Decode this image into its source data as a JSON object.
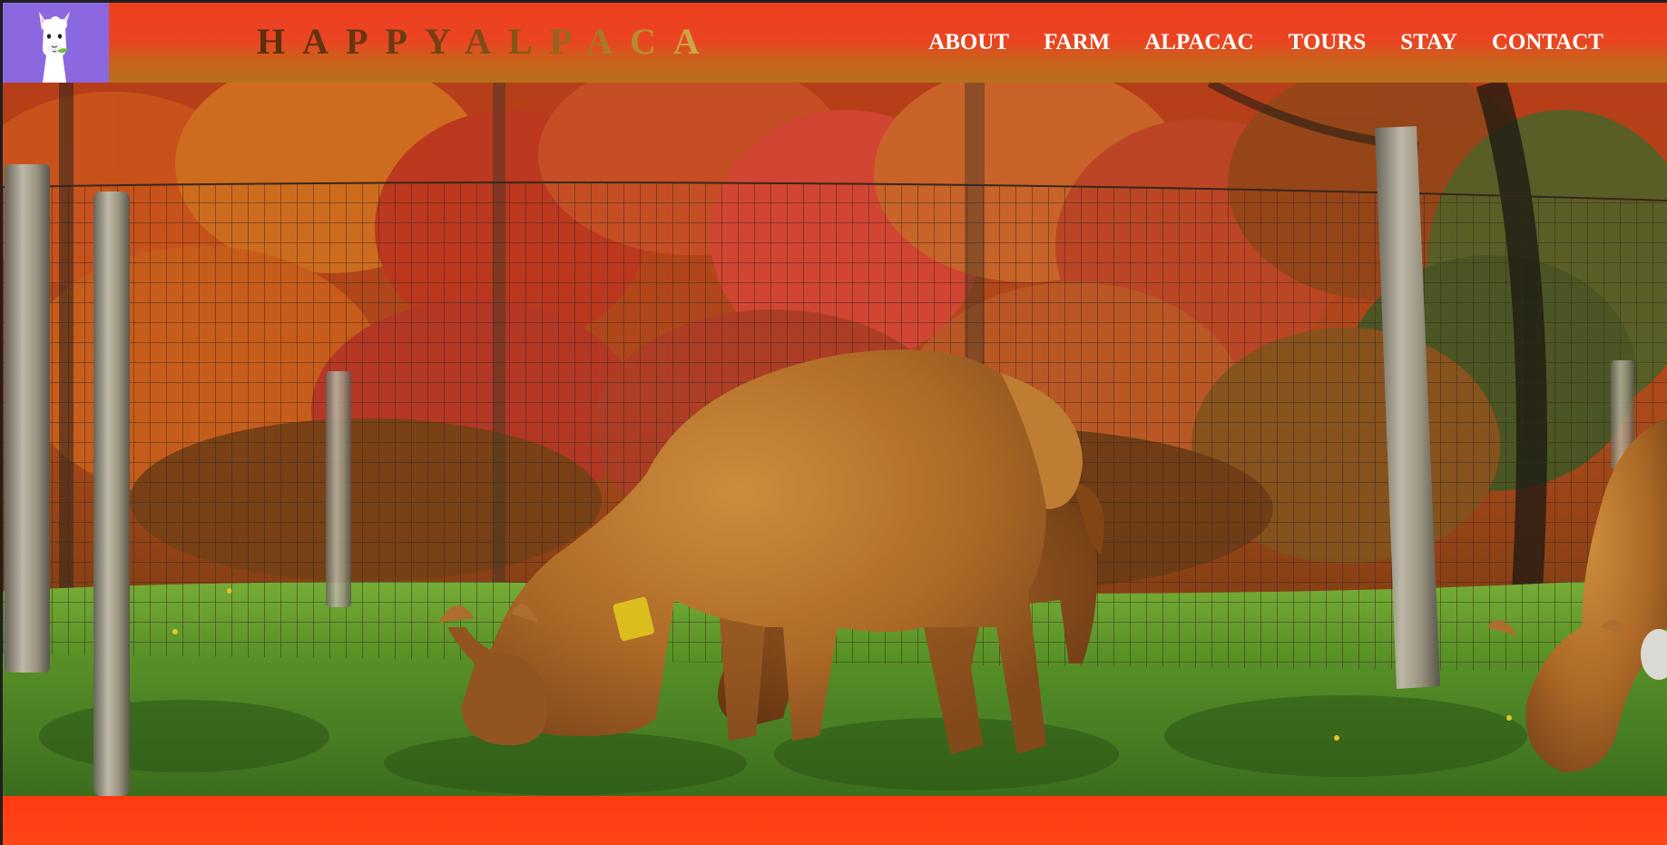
{
  "header": {
    "logo_icon": "alpaca-logo-icon",
    "brand_name": "HAPPYALPACA",
    "nav": [
      {
        "label": "ABOUT"
      },
      {
        "label": "FARM"
      },
      {
        "label": "ALPACAC"
      },
      {
        "label": "TOURS"
      },
      {
        "label": "STAY"
      },
      {
        "label": "CONTACT"
      }
    ]
  },
  "hero": {
    "image": "alpacas-grazing-by-fence-autumn-photo"
  },
  "colors": {
    "header_red": "#ee4020",
    "header_bottom_tint": "#b8701c",
    "logo_background": "#8c68e0",
    "bottom_band": "#ff3d14",
    "nav_text": "#ffffff"
  }
}
